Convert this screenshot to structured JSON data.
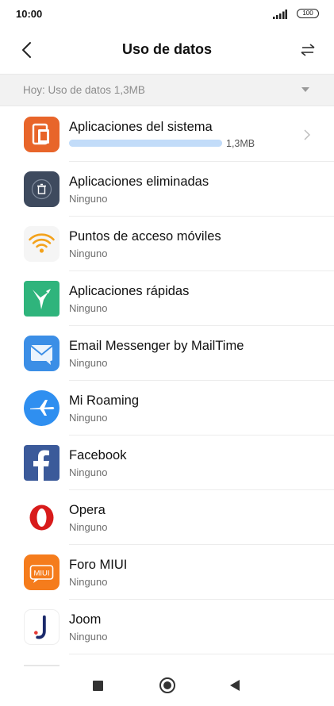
{
  "status_bar": {
    "time": "10:00",
    "battery": "100"
  },
  "header": {
    "title": "Uso de datos"
  },
  "filter": {
    "label": "Hoy: Uso de datos 1,3MB"
  },
  "apps": [
    {
      "name": "Aplicaciones del sistema",
      "usage": "1,3MB",
      "usage_fraction": 1.0,
      "icon": "system-apps-icon",
      "color": "#e8652a"
    },
    {
      "name": "Aplicaciones eliminadas",
      "sub": "Ninguno",
      "icon": "trash-icon",
      "color": "#3e4a5e"
    },
    {
      "name": "Puntos de acceso móviles",
      "sub": "Ninguno",
      "icon": "wifi-hotspot-icon",
      "color": "#f3a21c"
    },
    {
      "name": "Aplicaciones rápidas",
      "sub": "Ninguno",
      "icon": "hummingbird-icon",
      "color": "#2fb47c"
    },
    {
      "name": "Email Messenger by MailTime",
      "sub": "Ninguno",
      "icon": "mail-icon",
      "color": "#3b8ee6"
    },
    {
      "name": "Mi Roaming",
      "sub": "Ninguno",
      "icon": "airplane-icon",
      "color": "#2f8ff0"
    },
    {
      "name": "Facebook",
      "sub": "Ninguno",
      "icon": "facebook-icon",
      "color": "#3b5a9a"
    },
    {
      "name": "Opera",
      "sub": "Ninguno",
      "icon": "opera-icon",
      "color": "#d81b1b"
    },
    {
      "name": "Foro MIUI",
      "sub": "Ninguno",
      "icon": "miui-forum-icon",
      "color": "#f57c1c",
      "icon_text": "MIUI"
    },
    {
      "name": "Joom",
      "sub": "Ninguno",
      "icon": "joom-icon",
      "color": "#1b2a6b"
    }
  ]
}
